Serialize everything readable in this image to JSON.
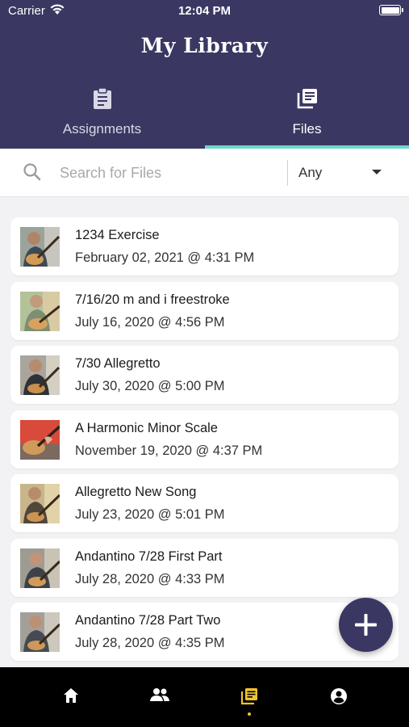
{
  "status_bar": {
    "carrier": "Carrier",
    "time": "12:04 PM"
  },
  "header": {
    "title": "My Library"
  },
  "tabs": [
    {
      "label": "Assignments",
      "icon": "clipboard-icon",
      "active": false
    },
    {
      "label": "Files",
      "icon": "library-icon",
      "active": true
    }
  ],
  "search": {
    "placeholder": "Search for Files",
    "value": ""
  },
  "filter": {
    "selected": "Any"
  },
  "files": [
    {
      "title": "1234 Exercise",
      "date": "February 02, 2021 @ 4:31 PM"
    },
    {
      "title": "7/16/20 m and i freestroke",
      "date": "July 16, 2020 @ 4:56 PM"
    },
    {
      "title": "7/30 Allegretto",
      "date": "July 30, 2020 @ 5:00 PM"
    },
    {
      "title": "A Harmonic Minor Scale",
      "date": "November 19, 2020 @ 4:37 PM"
    },
    {
      "title": "Allegretto New Song",
      "date": "July 23, 2020 @ 5:01 PM"
    },
    {
      "title": "Andantino 7/28 First Part",
      "date": "July 28, 2020 @ 4:33 PM"
    },
    {
      "title": "Andantino 7/28 Part Two",
      "date": "July 28, 2020 @ 4:35 PM"
    }
  ],
  "bottom_nav": [
    {
      "icon": "home-icon",
      "active": false
    },
    {
      "icon": "people-icon",
      "active": false
    },
    {
      "icon": "library-icon",
      "active": true
    },
    {
      "icon": "account-icon",
      "active": false
    }
  ],
  "colors": {
    "header": "#3a3862",
    "tab_indicator": "#6fd8c8",
    "active_nav": "#f2c32c",
    "fab": "#3a3862"
  }
}
